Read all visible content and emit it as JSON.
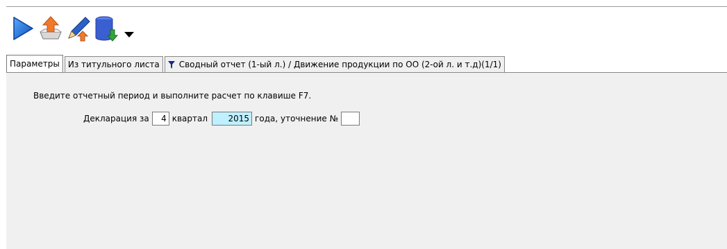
{
  "toolbar": {
    "buttons": [
      {
        "name": "run",
        "icon": "play-icon"
      },
      {
        "name": "export",
        "icon": "upload-tray-icon"
      },
      {
        "name": "edit",
        "icon": "pen-icon"
      },
      {
        "name": "database",
        "icon": "database-import-icon"
      },
      {
        "name": "more",
        "icon": "dropdown-arrow-icon"
      }
    ]
  },
  "tabs": [
    {
      "label": "Параметры",
      "active": true
    },
    {
      "label": "Из титульного листа",
      "active": false
    },
    {
      "label": "Сводный отчет (1-ый л.) / Движение продукции по ОО (2-ой л. и т.д)(1/1)",
      "active": false,
      "icon": "filter-icon"
    }
  ],
  "form": {
    "hint": "Введите отчетный период и выполните расчет по клавише F7.",
    "declaration_label": "Декларация за",
    "quarter_value": "4",
    "quarter_label": "квартал",
    "year_value": "2015",
    "year_label": "года, уточнение №",
    "correction_value": ""
  },
  "colors": {
    "year_field_bg": "#bff0ff",
    "panel_bg": "#f0f0f0"
  }
}
